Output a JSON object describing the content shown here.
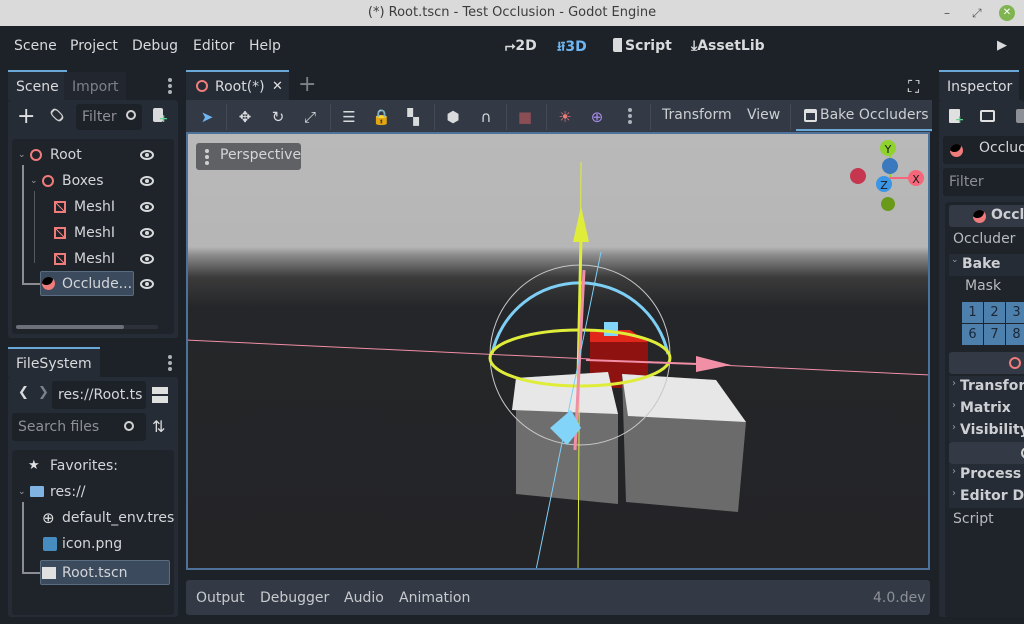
{
  "window": {
    "title": "(*) Root.tscn - Test Occlusion - Godot Engine",
    "minimize_glyph": "–",
    "maximize_glyph": "⤢",
    "close_glyph": "✕"
  },
  "menubar": {
    "items": [
      "Scene",
      "Project",
      "Debug",
      "Editor",
      "Help"
    ],
    "workspaces": [
      {
        "label": "2D",
        "icon": "2d-icon",
        "glyph": "⮣"
      },
      {
        "label": "3D",
        "icon": "3d-icon",
        "glyph": "⭿",
        "active": true
      },
      {
        "label": "Script",
        "icon": "script-icon",
        "glyph": "▮"
      },
      {
        "label": "AssetLib",
        "icon": "assetlib-icon",
        "glyph": "⤓"
      }
    ],
    "play_glyph": "▶"
  },
  "scene_dock": {
    "tabs": [
      "Scene",
      "Import"
    ],
    "filter_placeholder": "Filter",
    "add_glyph": "+",
    "link_glyph": "🔗",
    "tree": [
      {
        "label": "Root",
        "type": "node3d",
        "level": 0,
        "expanded": true
      },
      {
        "label": "Boxes",
        "type": "node3d",
        "level": 1,
        "expanded": true
      },
      {
        "label": "MeshI",
        "type": "mesh",
        "level": 2
      },
      {
        "label": "MeshI",
        "type": "mesh",
        "level": 2
      },
      {
        "label": "MeshI",
        "type": "mesh",
        "level": 2
      },
      {
        "label": "Occlude...",
        "type": "occluder",
        "level": 1,
        "selected": true
      }
    ]
  },
  "filesystem_dock": {
    "tab": "FileSystem",
    "path": "res://Root.ts",
    "search_placeholder": "Search files",
    "back_glyph": "❮",
    "forward_glyph": "❯",
    "items": [
      {
        "label": "Favorites:",
        "icon": "star-icon",
        "glyph": "★"
      },
      {
        "label": "res://",
        "icon": "folder-icon"
      },
      {
        "label": "default_env.tres",
        "icon": "globe-icon",
        "glyph": "⊕"
      },
      {
        "label": "icon.png",
        "icon": "image-icon"
      },
      {
        "label": "Root.tscn",
        "icon": "scene-file-icon",
        "selected": true
      }
    ]
  },
  "editor": {
    "scene_tab": "Root(*)",
    "close_glyph": "✕",
    "add_tab_glyph": "+",
    "toolbar": {
      "transform_menu": "Transform",
      "view_menu": "View",
      "bake_button": "Bake Occluders"
    },
    "viewport": {
      "perspective_label": "Perspective",
      "gizmo_axes": [
        "Y",
        "X",
        "Z"
      ]
    }
  },
  "inspector": {
    "tab": "Inspector",
    "object_name": "Occlude",
    "filter_placeholder": "Filter prope",
    "section_title": "Occlu",
    "occluder_label": "Occluder",
    "bake_group": "Bake",
    "mask_label": "Mask",
    "mask_cells": [
      "1",
      "2",
      "3",
      "6",
      "7",
      "8"
    ],
    "node3d_groups": [
      "Transform",
      "Matrix",
      "Visibility"
    ],
    "node_groups": [
      "Process",
      "Editor De"
    ],
    "script_label": "Script"
  },
  "bottom_panel": {
    "tabs": [
      "Output",
      "Debugger",
      "Audio",
      "Animation"
    ],
    "version": "4.0.dev"
  },
  "colors": {
    "accent": "#6aa8d8",
    "node_red": "#f07b7b",
    "axis_x": "#f5667a",
    "axis_y": "#8fd22e",
    "axis_z": "#3b96e6"
  }
}
